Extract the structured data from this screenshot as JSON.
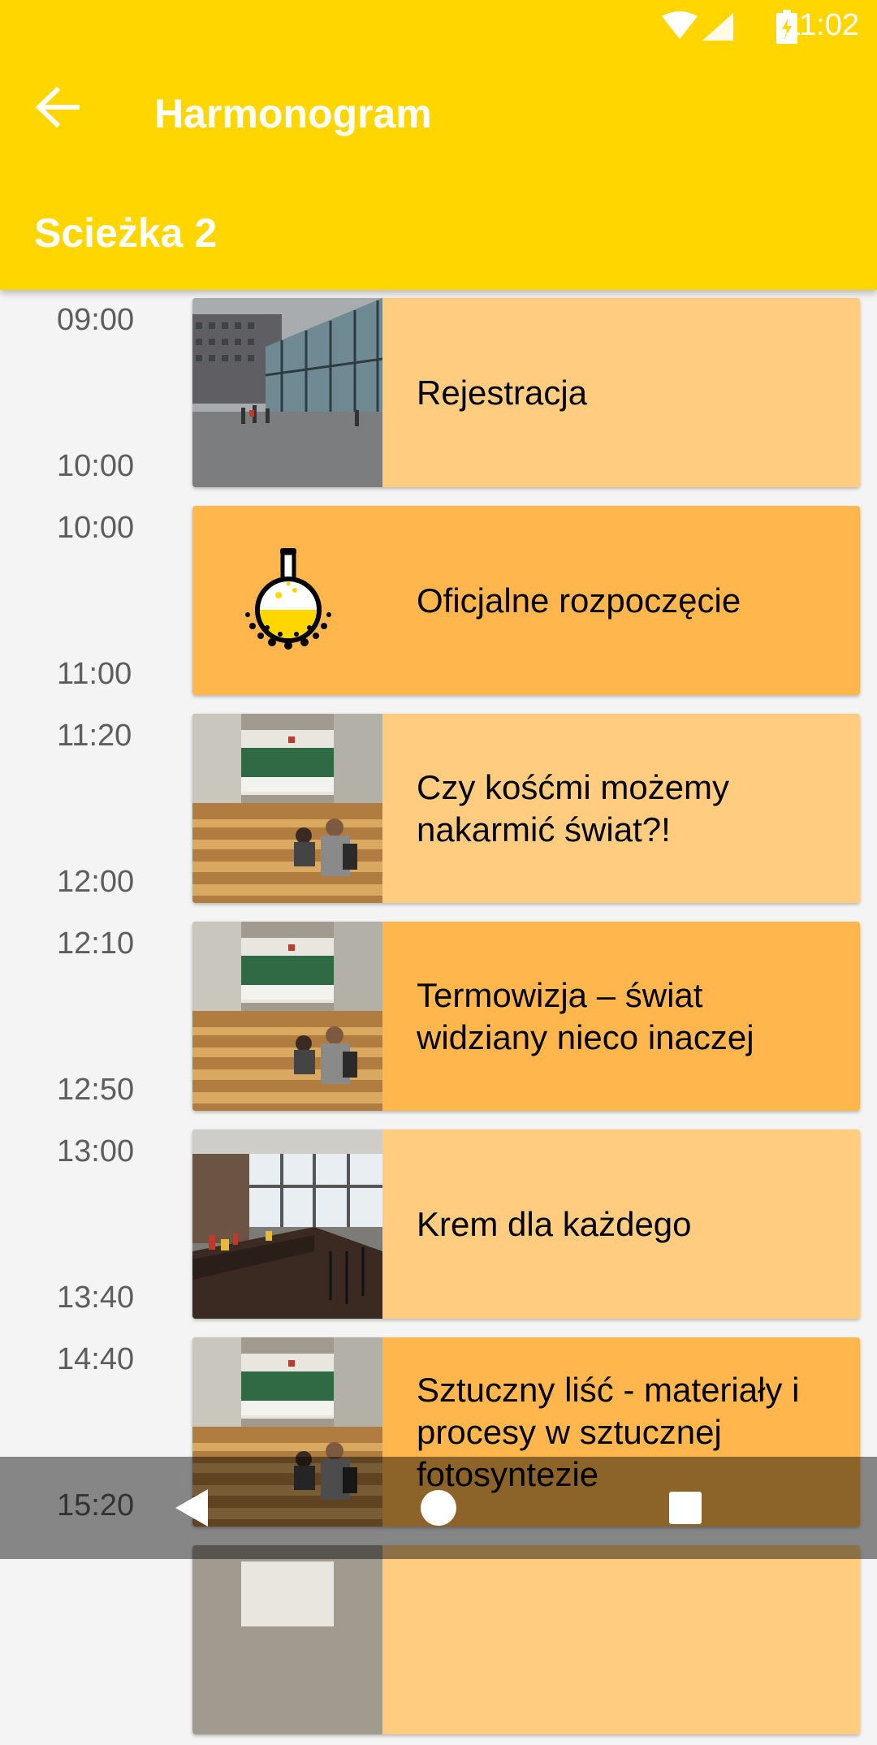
{
  "status_bar": {
    "time": "11:02",
    "icons": [
      "wifi-icon",
      "signal-icon",
      "battery-charging-icon"
    ]
  },
  "app_bar": {
    "back_icon": "arrow-back-icon",
    "title": "Harmonogram",
    "track": "Scieżka 2"
  },
  "colors": {
    "primary": "#ffd600",
    "card_light": "#ffcc80",
    "card_dark": "#ffb74d",
    "time_text": "#5d5d5d"
  },
  "events": [
    {
      "start": "09:00",
      "end": "10:00",
      "title": "Rejestracja",
      "image": "building-photo"
    },
    {
      "start": "10:00",
      "end": "11:00",
      "title": "Oficjalne rozpoczęcie",
      "image": "flask-icon"
    },
    {
      "start": "11:20",
      "end": "12:00",
      "title": "Czy kośćmi możemy nakarmić świat?!",
      "image": "lecture-hall-photo"
    },
    {
      "start": "12:10",
      "end": "12:50",
      "title": "Termowizja – świat widziany nieco inaczej",
      "image": "lecture-hall-photo"
    },
    {
      "start": "13:00",
      "end": "13:40",
      "title": "Krem dla każdego",
      "image": "laboratory-photo"
    },
    {
      "start": "14:40",
      "end": "15:20",
      "title": "Sztuczny liść - materiały i procesy w sztucznej fotosyntezie",
      "image": "lecture-hall-photo"
    }
  ],
  "nav_bar": {
    "buttons": [
      "back-triangle-icon",
      "home-circle-icon",
      "recents-square-icon"
    ]
  }
}
